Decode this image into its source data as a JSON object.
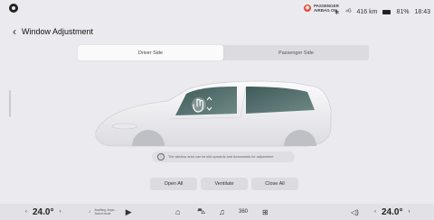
{
  "status": {
    "airbag_line1": "PASSENGER",
    "airbag_line2": "AIRBAG ON",
    "range": "416 km",
    "battery": "81%",
    "time": "18:43",
    "signal": "⁴ᴳ"
  },
  "header": {
    "title": "Window Adjustment"
  },
  "tabs": [
    {
      "label": "Driver Side",
      "active": true
    },
    {
      "label": "Passenger Side",
      "active": false
    }
  ],
  "hint": {
    "text": "The window area can be slid upwards and downwards for adjustment"
  },
  "actions": {
    "open_all": "Open All",
    "ventilate": "Ventilate",
    "close_all": "Close All"
  },
  "dock": {
    "left_temp": "24.0°",
    "right_temp": "24.0°",
    "media_line1": "Anything, Anyw...",
    "media_line2": "Sound mode",
    "fan_label": "360"
  },
  "colors": {
    "airbag_red": "#e04a3a",
    "window_tint": "#4a6a6a",
    "body_white": "#f4f4f6"
  }
}
